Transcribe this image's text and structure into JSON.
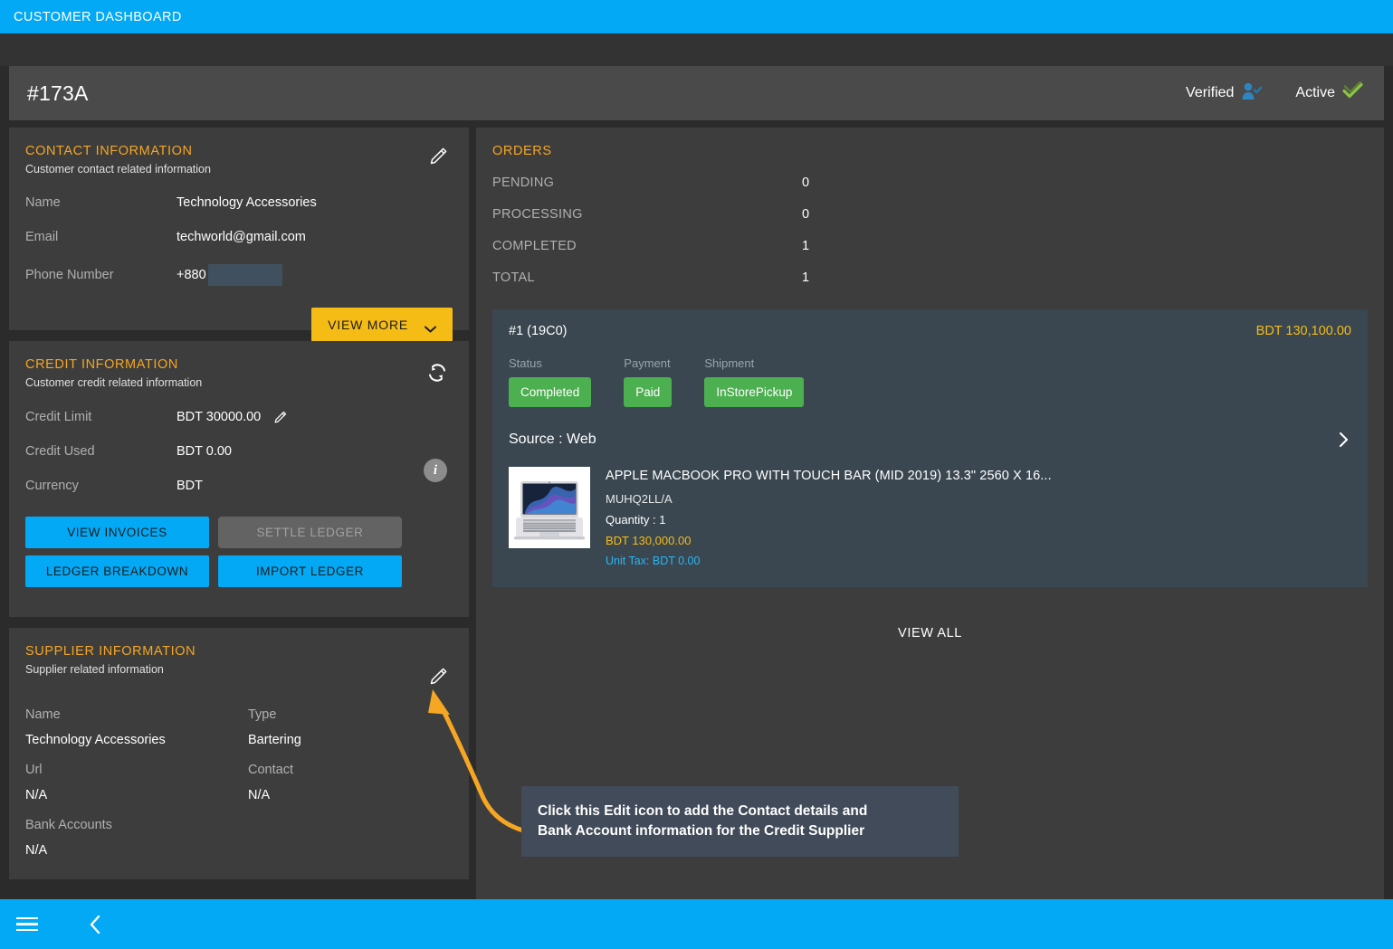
{
  "topbar": {
    "title": "CUSTOMER DASHBOARD"
  },
  "header": {
    "customer_id": "#173A",
    "verified_label": "Verified",
    "active_label": "Active",
    "verified_icon": "user-check-icon",
    "active_icon": "double-check-icon"
  },
  "contact": {
    "title": "CONTACT INFORMATION",
    "subtitle": "Customer contact related information",
    "edit_icon": "pencil-icon",
    "fields": [
      {
        "label": "Name",
        "value": "Technology Accessories"
      },
      {
        "label": "Email",
        "value": "techworld@gmail.com"
      },
      {
        "label": "Phone Number",
        "value": "+880"
      }
    ],
    "view_more_label": "VIEW MORE"
  },
  "credit": {
    "title": "CREDIT INFORMATION",
    "subtitle": "Customer credit related information",
    "refresh_icon": "refresh-icon",
    "info_icon": "info-icon",
    "fields": [
      {
        "label": "Credit Limit",
        "value": "BDT 30000.00"
      },
      {
        "label": "Credit Used",
        "value": "BDT 0.00"
      },
      {
        "label": "Currency",
        "value": "BDT"
      }
    ],
    "buttons": {
      "view_invoices": "VIEW INVOICES",
      "settle_ledger": "SETTLE LEDGER",
      "ledger_breakdown": "LEDGER BREAKDOWN",
      "import_ledger": "IMPORT LEDGER"
    }
  },
  "supplier": {
    "title": "SUPPLIER INFORMATION",
    "subtitle": "Supplier related information",
    "edit_icon": "pencil-icon",
    "name_label": "Name",
    "name_value": "Technology Accessories",
    "type_label": "Type",
    "type_value": "Bartering",
    "url_label": "Url",
    "url_value": "N/A",
    "contact_label": "Contact",
    "contact_value": "N/A",
    "bank_label": "Bank Accounts",
    "bank_value": "N/A"
  },
  "orders": {
    "title": "ORDERS",
    "stats": [
      {
        "label": "PENDING",
        "value": "0"
      },
      {
        "label": "PROCESSING",
        "value": "0"
      },
      {
        "label": "COMPLETED",
        "value": "1"
      },
      {
        "label": "TOTAL",
        "value": "1"
      }
    ],
    "card": {
      "order_id": "#1 (19C0)",
      "amount": "BDT 130,100.00",
      "status_label": "Status",
      "status_value": "Completed",
      "payment_label": "Payment",
      "payment_value": "Paid",
      "shipment_label": "Shipment",
      "shipment_value": "InStorePickup",
      "source": "Source : Web",
      "expand_icon": "chevron-right-icon",
      "product": {
        "name": "APPLE MACBOOK PRO WITH TOUCH BAR (MID 2019) 13.3\" 2560 X 16...",
        "sku": "MUHQ2LL/A",
        "quantity": "Quantity : 1",
        "price": "BDT 130,000.00",
        "unit_tax": "Unit Tax: BDT 0.00",
        "thumbnail": "macbook-pro-thumbnail"
      }
    },
    "view_all_label": "VIEW ALL"
  },
  "callout": {
    "line1": "Click this Edit icon to add the Contact details and",
    "line2": "Bank Account information for the Credit Supplier"
  },
  "bottombar": {
    "menu_icon": "hamburger-menu-icon",
    "back_icon": "chevron-left-icon"
  },
  "colors": {
    "accent_blue": "#03a9f4",
    "accent_yellow": "#f5bc16",
    "title_orange": "#f5a623",
    "badge_green": "#4caf50",
    "panel_bg": "#3d3d3d",
    "order_card_bg": "#3a4750",
    "active_green": "#8bc34a"
  }
}
